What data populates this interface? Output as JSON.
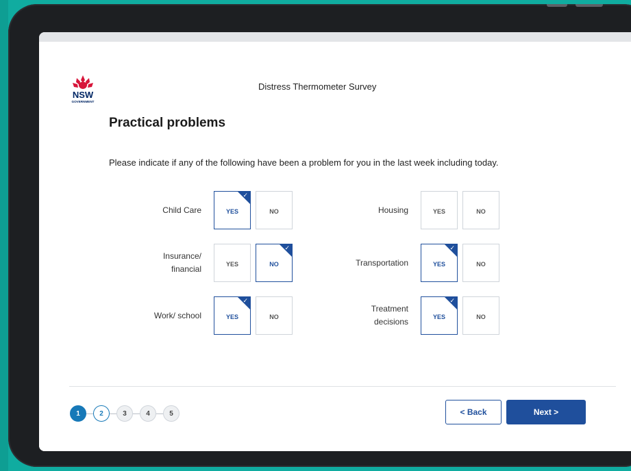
{
  "survey_title": "Distress Thermometer Survey",
  "heading": "Practical problems",
  "intro": "Please indicate if any of the following have been a problem for you in the last week including today.",
  "logo": {
    "text": "NSW",
    "subtext": "GOVERNMENT",
    "icon": "waratah-flower-icon"
  },
  "options": {
    "yes": "YES",
    "no": "NO"
  },
  "questions_left": [
    {
      "label_lines": [
        "Child Care"
      ],
      "selected": "yes"
    },
    {
      "label_lines": [
        "Insurance/",
        "financial"
      ],
      "selected": "no"
    },
    {
      "label_lines": [
        "Work/ school"
      ],
      "selected": "yes"
    }
  ],
  "questions_right": [
    {
      "label_lines": [
        "Housing"
      ],
      "selected": null
    },
    {
      "label_lines": [
        "Transportation"
      ],
      "selected": "yes"
    },
    {
      "label_lines": [
        "Treatment",
        "decisions"
      ],
      "selected": "yes"
    }
  ],
  "steps": [
    "1",
    "2",
    "3",
    "4",
    "5"
  ],
  "current_step": 1,
  "buttons": {
    "back": "< Back",
    "next": "Next >"
  },
  "colors": {
    "accent": "#1f4f9c",
    "step_active": "#1779b8",
    "background": "#10aca0",
    "logo_red": "#d7153a"
  }
}
